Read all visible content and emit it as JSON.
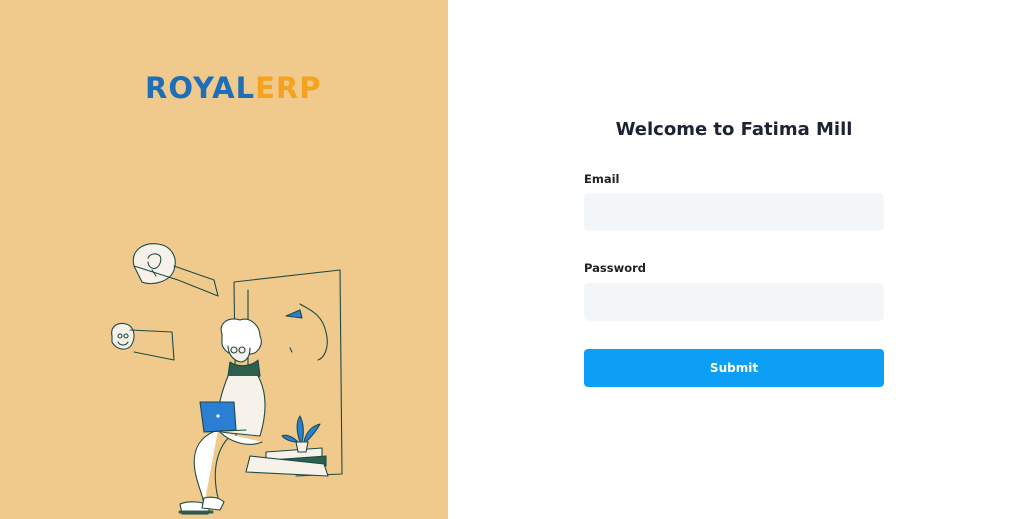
{
  "brand": {
    "part1": "ROYAL",
    "part2": "ERP"
  },
  "form": {
    "title": "Welcome to Fatima Mill",
    "email_label": "Email",
    "email_value": "",
    "password_label": "Password",
    "password_value": "",
    "submit_label": "Submit"
  },
  "colors": {
    "left_panel_bg": "#f0c98c",
    "brand_blue": "#1f6fb8",
    "brand_orange": "#f5a21d",
    "input_bg": "#f3f6f9",
    "button_bg": "#0d9ff5"
  },
  "illustration": {
    "icon": "person-with-laptop-illustration"
  }
}
